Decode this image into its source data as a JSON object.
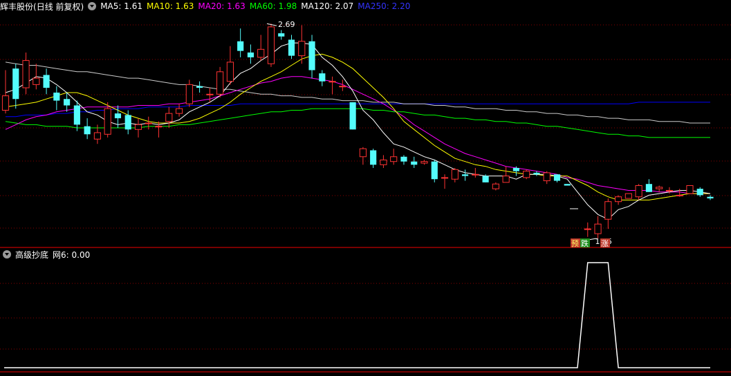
{
  "main_header": {
    "stock_name": "辉丰股份",
    "period": "(日线 前复权)",
    "ma": [
      {
        "label": "MA5: 1.61",
        "color": "#ffffff"
      },
      {
        "label": "MA10: 1.63",
        "color": "#ffff00"
      },
      {
        "label": "MA20: 1.63",
        "color": "#ff00ff"
      },
      {
        "label": "MA60: 1.98",
        "color": "#00ff00"
      },
      {
        "label": "MA120: 2.07",
        "color": "#ffffff"
      },
      {
        "label": "MA250: 2.20",
        "color": "#3333ff"
      }
    ]
  },
  "sub_header": {
    "indicator_name": "高级抄底",
    "value_label": "网6: 0.00"
  },
  "annotations": {
    "high_label": "2.69",
    "low_label": "1.35",
    "tag_predict": "预",
    "tag_drop": "跌",
    "tag_rise": "涨"
  },
  "colors": {
    "up": "#ff3333",
    "down": "#54fcfc",
    "grid": "#8b0000",
    "separator": "#a00000",
    "ma5": "#ffffff",
    "ma10": "#ffff00",
    "ma20": "#ff00ff",
    "ma60": "#00ff00",
    "ma120": "#cccccc",
    "ma250": "#0000ff"
  },
  "chart_data": {
    "type": "candlestick",
    "y_range": [
      1.32,
      2.76
    ],
    "candles": [
      [
        2.15,
        2.24,
        2.4,
        2.13
      ],
      [
        2.41,
        2.22,
        2.44,
        2.16
      ],
      [
        2.29,
        2.46,
        2.51,
        2.25
      ],
      [
        2.31,
        2.35,
        2.44,
        2.28
      ],
      [
        2.37,
        2.29,
        2.41,
        2.25
      ],
      [
        2.26,
        2.21,
        2.3,
        2.15
      ],
      [
        2.22,
        2.18,
        2.26,
        2.14
      ],
      [
        2.18,
        2.06,
        2.21,
        2.02
      ],
      [
        2.05,
        2.0,
        2.1,
        1.97
      ],
      [
        1.97,
        2.01,
        2.06,
        1.94
      ],
      [
        2.0,
        2.16,
        2.2,
        1.98
      ],
      [
        2.13,
        2.1,
        2.18,
        2.04
      ],
      [
        2.12,
        2.03,
        2.15,
        2.0
      ],
      [
        2.03,
        2.06,
        2.1,
        1.98
      ],
      [
        2.07,
        2.07,
        2.11,
        2.03
      ],
      [
        2.05,
        2.05,
        2.08,
        1.98
      ],
      [
        2.08,
        2.13,
        2.17,
        2.04
      ],
      [
        2.13,
        2.16,
        2.19,
        2.11
      ],
      [
        2.19,
        2.31,
        2.34,
        2.17
      ],
      [
        2.3,
        2.29,
        2.33,
        2.26
      ],
      [
        2.25,
        2.25,
        2.29,
        2.2
      ],
      [
        2.25,
        2.39,
        2.42,
        2.23
      ],
      [
        2.33,
        2.45,
        2.55,
        2.31
      ],
      [
        2.58,
        2.52,
        2.66,
        2.48
      ],
      [
        2.51,
        2.48,
        2.56,
        2.44
      ],
      [
        2.48,
        2.53,
        2.62,
        2.46
      ],
      [
        2.44,
        2.67,
        2.69,
        2.42
      ],
      [
        2.63,
        2.61,
        2.65,
        2.59
      ],
      [
        2.59,
        2.49,
        2.62,
        2.47
      ],
      [
        2.49,
        2.58,
        2.68,
        2.44
      ],
      [
        2.58,
        2.4,
        2.62,
        2.35
      ],
      [
        2.38,
        2.33,
        2.4,
        2.3
      ],
      [
        2.33,
        2.33,
        2.36,
        2.25
      ],
      [
        2.3,
        2.3,
        2.34,
        2.27
      ],
      [
        2.2,
        2.03,
        2.2,
        2.03
      ],
      [
        1.86,
        1.91,
        1.92,
        1.81
      ],
      [
        1.9,
        1.81,
        1.91,
        1.79
      ],
      [
        1.81,
        1.84,
        1.87,
        1.79
      ],
      [
        1.83,
        1.86,
        1.91,
        1.81
      ],
      [
        1.86,
        1.83,
        1.87,
        1.81
      ],
      [
        1.83,
        1.81,
        1.86,
        1.79
      ],
      [
        1.82,
        1.83,
        1.84,
        1.81
      ],
      [
        1.83,
        1.72,
        1.84,
        1.7
      ],
      [
        1.73,
        1.73,
        1.75,
        1.66
      ],
      [
        1.72,
        1.78,
        1.79,
        1.7
      ],
      [
        1.75,
        1.74,
        1.78,
        1.71
      ],
      [
        1.75,
        1.75,
        1.79,
        1.73
      ],
      [
        1.74,
        1.7,
        1.75,
        1.7
      ],
      [
        1.66,
        1.69,
        1.7,
        1.65
      ],
      [
        1.7,
        1.74,
        1.8,
        1.7
      ],
      [
        1.79,
        1.77,
        1.8,
        1.74
      ],
      [
        1.73,
        1.77,
        1.78,
        1.72
      ],
      [
        1.76,
        1.75,
        1.77,
        1.74
      ],
      [
        1.71,
        1.76,
        1.77,
        1.69
      ],
      [
        1.75,
        1.71,
        1.75,
        1.7
      ],
      [
        1.69,
        1.68,
        1.69,
        1.68
      ],
      [
        null,
        null,
        null,
        null
      ],
      [
        1.41,
        1.41,
        1.45,
        1.36
      ],
      [
        1.38,
        1.44,
        1.49,
        1.35
      ],
      [
        1.47,
        1.58,
        1.6,
        1.41
      ],
      [
        1.58,
        1.61,
        1.62,
        1.56
      ],
      [
        1.6,
        1.63,
        1.63,
        1.6
      ],
      [
        1.61,
        1.68,
        1.69,
        1.59
      ],
      [
        1.69,
        1.64,
        1.72,
        1.64
      ],
      [
        1.66,
        1.67,
        1.68,
        1.64
      ],
      [
        1.65,
        1.65,
        1.67,
        1.63
      ],
      [
        1.62,
        1.62,
        1.66,
        1.61
      ],
      [
        1.63,
        1.68,
        1.68,
        1.63
      ],
      [
        1.66,
        1.62,
        1.67,
        1.61
      ],
      [
        1.61,
        1.6,
        1.62,
        1.59
      ]
    ],
    "ma5": [
      2.26,
      2.28,
      2.32,
      2.36,
      2.35,
      2.31,
      2.26,
      2.2,
      2.14,
      2.12,
      2.08,
      2.06,
      2.07,
      2.06,
      2.07,
      2.06,
      2.07,
      2.09,
      2.14,
      2.17,
      2.2,
      2.24,
      2.32,
      2.38,
      2.41,
      2.46,
      2.5,
      2.55,
      2.57,
      2.57,
      2.56,
      2.48,
      2.43,
      2.36,
      2.27,
      2.15,
      2.09,
      2.01,
      1.94,
      1.92,
      1.89,
      1.86,
      1.84,
      1.81,
      1.78,
      1.76,
      1.75,
      1.74,
      1.74,
      1.74,
      1.72,
      1.75,
      1.75,
      1.75,
      1.74,
      1.72,
      1.64,
      1.56,
      1.5,
      1.47,
      1.53,
      1.55,
      1.59,
      1.62,
      1.63,
      1.64,
      1.65,
      1.65,
      1.64,
      1.63
    ],
    "ma10": [
      2.17,
      2.18,
      2.19,
      2.2,
      2.22,
      2.24,
      2.26,
      2.26,
      2.24,
      2.21,
      2.18,
      2.15,
      2.12,
      2.1,
      2.08,
      2.07,
      2.07,
      2.07,
      2.08,
      2.1,
      2.13,
      2.16,
      2.2,
      2.25,
      2.29,
      2.33,
      2.36,
      2.39,
      2.43,
      2.47,
      2.49,
      2.5,
      2.48,
      2.45,
      2.41,
      2.35,
      2.29,
      2.23,
      2.16,
      2.08,
      2.03,
      1.98,
      1.93,
      1.89,
      1.85,
      1.83,
      1.81,
      1.8,
      1.78,
      1.77,
      1.76,
      1.75,
      1.75,
      1.74,
      1.74,
      1.74,
      1.71,
      1.68,
      1.64,
      1.61,
      1.59,
      1.59,
      1.59,
      1.59,
      1.6,
      1.61,
      1.62,
      1.63,
      1.63,
      1.63
    ],
    "ma20": [
      2.03,
      2.06,
      2.09,
      2.11,
      2.12,
      2.14,
      2.15,
      2.16,
      2.17,
      2.17,
      2.17,
      2.17,
      2.17,
      2.18,
      2.18,
      2.18,
      2.19,
      2.19,
      2.2,
      2.21,
      2.22,
      2.24,
      2.26,
      2.28,
      2.3,
      2.32,
      2.33,
      2.35,
      2.36,
      2.36,
      2.35,
      2.34,
      2.33,
      2.31,
      2.28,
      2.25,
      2.22,
      2.19,
      2.15,
      2.11,
      2.06,
      2.02,
      1.98,
      1.94,
      1.91,
      1.88,
      1.86,
      1.84,
      1.82,
      1.8,
      1.79,
      1.78,
      1.77,
      1.76,
      1.75,
      1.73,
      1.72,
      1.7,
      1.68,
      1.67,
      1.66,
      1.65,
      1.65,
      1.65,
      1.64,
      1.64,
      1.64,
      1.63,
      1.63,
      1.63
    ],
    "ma60": [
      2.08,
      2.07,
      2.06,
      2.06,
      2.05,
      2.05,
      2.05,
      2.04,
      2.04,
      2.04,
      2.04,
      2.04,
      2.04,
      2.04,
      2.05,
      2.05,
      2.05,
      2.06,
      2.06,
      2.07,
      2.08,
      2.09,
      2.1,
      2.11,
      2.12,
      2.13,
      2.14,
      2.14,
      2.15,
      2.15,
      2.16,
      2.16,
      2.16,
      2.16,
      2.16,
      2.16,
      2.15,
      2.15,
      2.14,
      2.14,
      2.13,
      2.12,
      2.12,
      2.11,
      2.1,
      2.1,
      2.09,
      2.09,
      2.08,
      2.08,
      2.07,
      2.07,
      2.06,
      2.05,
      2.05,
      2.04,
      2.03,
      2.02,
      2.01,
      2.0,
      2.0,
      1.99,
      1.99,
      1.98,
      1.98,
      1.98,
      1.98,
      1.98,
      1.98,
      1.98
    ],
    "ma120": [
      2.45,
      2.44,
      2.43,
      2.43,
      2.42,
      2.41,
      2.4,
      2.39,
      2.39,
      2.38,
      2.37,
      2.36,
      2.35,
      2.35,
      2.34,
      2.33,
      2.32,
      2.31,
      2.31,
      2.3,
      2.29,
      2.28,
      2.28,
      2.27,
      2.26,
      2.25,
      2.25,
      2.24,
      2.24,
      2.23,
      2.23,
      2.22,
      2.22,
      2.21,
      2.21,
      2.21,
      2.2,
      2.2,
      2.2,
      2.19,
      2.19,
      2.19,
      2.18,
      2.18,
      2.17,
      2.17,
      2.16,
      2.16,
      2.16,
      2.15,
      2.15,
      2.14,
      2.14,
      2.13,
      2.13,
      2.12,
      2.12,
      2.11,
      2.11,
      2.1,
      2.1,
      2.09,
      2.09,
      2.09,
      2.08,
      2.08,
      2.08,
      2.07,
      2.07,
      2.07
    ],
    "ma250": [
      2.11,
      2.11,
      2.12,
      2.12,
      2.12,
      2.13,
      2.13,
      2.14,
      2.14,
      2.15,
      2.15,
      2.16,
      2.16,
      2.16,
      2.17,
      2.17,
      2.17,
      2.17,
      2.18,
      2.18,
      2.18,
      2.18,
      2.18,
      2.19,
      2.19,
      2.19,
      2.19,
      2.19,
      2.19,
      2.19,
      2.19,
      2.19,
      2.19,
      2.19,
      2.19,
      2.19,
      2.19,
      2.19,
      2.19,
      2.19,
      2.19,
      2.19,
      2.19,
      2.19,
      2.19,
      2.19,
      2.19,
      2.19,
      2.19,
      2.19,
      2.19,
      2.19,
      2.19,
      2.19,
      2.19,
      2.19,
      2.19,
      2.19,
      2.19,
      2.19,
      2.19,
      2.19,
      2.2,
      2.2,
      2.2,
      2.2,
      2.2,
      2.2,
      2.2,
      2.2
    ],
    "indicator": [
      0,
      0,
      0,
      0,
      0,
      0,
      0,
      0,
      0,
      0,
      0,
      0,
      0,
      0,
      0,
      0,
      0,
      0,
      0,
      0,
      0,
      0,
      0,
      0,
      0,
      0,
      0,
      0,
      0,
      0,
      0,
      0,
      0,
      0,
      0,
      0,
      0,
      0,
      0,
      0,
      0,
      0,
      0,
      0,
      0,
      0,
      0,
      0,
      0,
      0,
      0,
      0,
      0,
      0,
      0,
      0,
      0,
      1,
      1,
      1,
      0,
      0,
      0,
      0,
      0,
      0,
      0,
      0,
      0,
      0
    ]
  }
}
